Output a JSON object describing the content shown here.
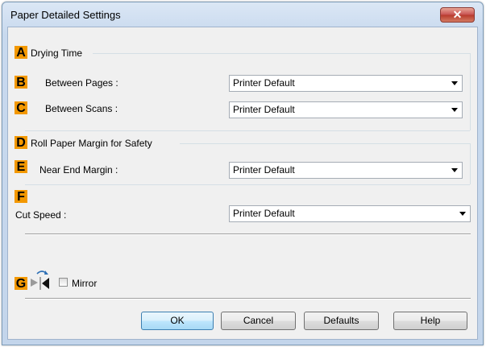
{
  "window": {
    "title": "Paper Detailed Settings",
    "close_glyph": "✕"
  },
  "drying_time": {
    "badge": "A",
    "title": "Drying Time",
    "between_pages": {
      "badge": "B",
      "label": "Between Pages :",
      "value": "Printer Default"
    },
    "between_scans": {
      "badge": "C",
      "label": "Between Scans :",
      "value": "Printer Default"
    }
  },
  "roll_margin": {
    "badge": "D",
    "title": "Roll Paper Margin for Safety",
    "near_end": {
      "badge": "E",
      "label": "Near End Margin :",
      "value": "Printer Default"
    }
  },
  "cut_speed": {
    "badge": "F",
    "label": "Cut Speed :",
    "value": "Printer Default"
  },
  "mirror": {
    "badge": "G",
    "label": "Mirror",
    "checked": false,
    "icon": "mirror-icon"
  },
  "buttons": {
    "ok": "OK",
    "cancel": "Cancel",
    "defaults": "Defaults",
    "help": "Help"
  },
  "colors": {
    "badge": "#f39800",
    "close": "#c75050",
    "default_button": "#3c7fb1"
  }
}
